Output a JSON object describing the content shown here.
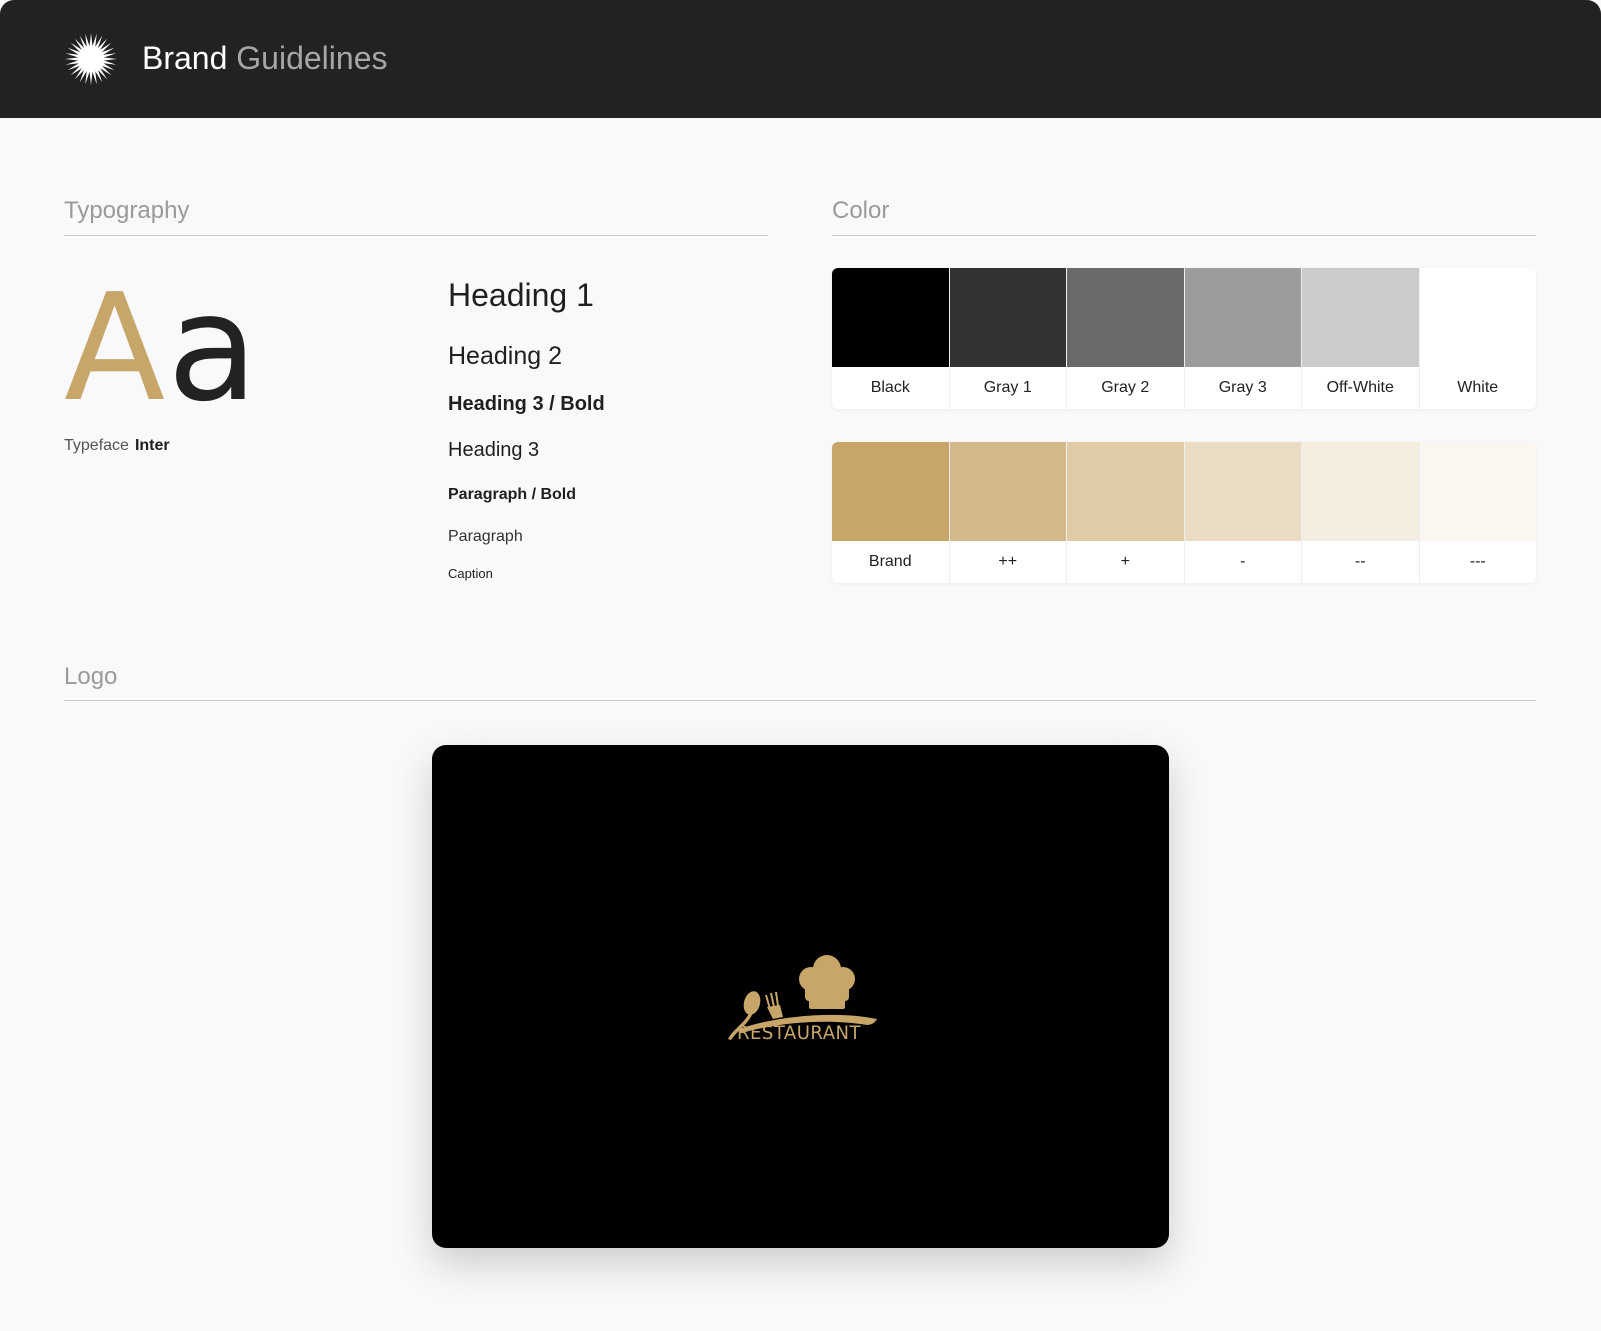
{
  "header": {
    "title_primary": "Brand",
    "title_secondary": "Guidelines",
    "logo_icon": "starburst-icon"
  },
  "typography": {
    "section_title": "Typography",
    "specimen_upper": "A",
    "specimen_lower": "a",
    "typeface_label": "Typeface",
    "typeface_value": "Inter",
    "hierarchy": [
      "Heading 1",
      "Heading 2",
      "Heading 3 / Bold",
      "Heading 3",
      "Paragraph / Bold",
      "Paragraph",
      "Caption"
    ]
  },
  "color": {
    "section_title": "Color",
    "neutrals": [
      {
        "name": "Black",
        "hex": "#000000"
      },
      {
        "name": "Gray 1",
        "hex": "#333333"
      },
      {
        "name": "Gray 2",
        "hex": "#6a6a6a"
      },
      {
        "name": "Gray 3",
        "hex": "#9c9c9c"
      },
      {
        "name": "Off-White",
        "hex": "#cbcbcb"
      },
      {
        "name": "White",
        "hex": "#ffffff"
      }
    ],
    "brand": [
      {
        "name": "Brand",
        "hex": "#c8a66a"
      },
      {
        "name": "++",
        "hex": "#d5b98a"
      },
      {
        "name": "+",
        "hex": "#dfcca7"
      },
      {
        "name": "-",
        "hex": "#e9dcc3"
      },
      {
        "name": "--",
        "hex": "#f4ede0"
      },
      {
        "name": "---",
        "hex": "#faf7f0"
      }
    ]
  },
  "logo": {
    "section_title": "Logo",
    "wordmark": "RESTAURANT",
    "background": "#000000",
    "accent": "#c8a66a"
  }
}
